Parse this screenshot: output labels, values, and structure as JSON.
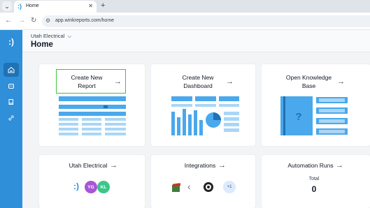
{
  "browser": {
    "tab_title": "Home",
    "url": "app.winkreports.com/home"
  },
  "header": {
    "org_name": "Utah Electrical",
    "page_title": "Home"
  },
  "cards": {
    "create_report": "Create New Report",
    "create_dashboard": "Create New Dashboard",
    "open_kb": "Open Knowledge Base",
    "utah_electrical": "Utah Electrical",
    "integrations": "Integrations",
    "automation_runs": "Automation Runs"
  },
  "avatars": [
    "YG",
    "KL"
  ],
  "integrations_more": "+1",
  "automation": {
    "total_label": "Total",
    "total_value": "0"
  },
  "colors": {
    "sidebar": "#2f8fd8",
    "accent": "#41c13b",
    "illustration": "#4aa8ec"
  }
}
